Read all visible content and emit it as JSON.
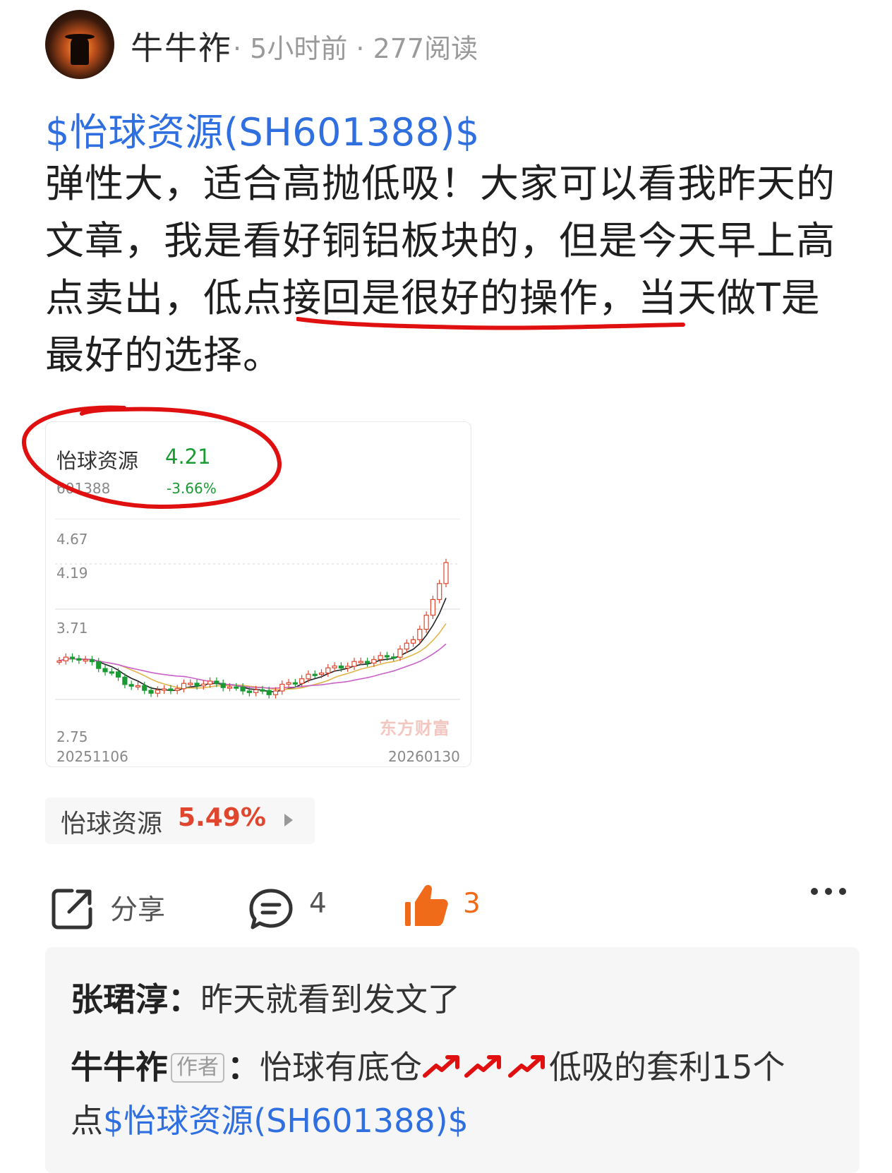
{
  "post": {
    "author": "牛牛祚",
    "meta": "· 5小时前 · 277阅读",
    "stock_link": "$怡球资源(SH601388)$",
    "body_before": "弹性大，适合高抛低吸！大家可以看我昨天的文章，我是看好铜铝板块的，但是今天早上高点卖出，",
    "body_underlined": "低点接回是很好的操作",
    "body_after": "，当天做T是最好的选择。"
  },
  "chart_card": {
    "name": "怡球资源",
    "price": "4.21",
    "code": "601388",
    "change": "-3.66%",
    "y_ticks": [
      "4.67",
      "4.19",
      "3.71",
      "2.75"
    ],
    "x_start": "20251106",
    "x_end": "20260130",
    "watermark": "东方财富"
  },
  "chart_data": {
    "type": "line",
    "title": "怡球资源",
    "ylim": [
      2.75,
      4.67
    ],
    "x": [
      "20251106",
      "20260130"
    ],
    "series": [
      {
        "name": "",
        "values": [
          3.16,
          3.2,
          3.12,
          3.02,
          2.9,
          2.84,
          2.84,
          2.9,
          2.92,
          2.92,
          2.86,
          2.84,
          2.82,
          2.92,
          2.98,
          3.06,
          3.1,
          3.14,
          3.18,
          3.22,
          3.36,
          3.66,
          4.21
        ]
      }
    ]
  },
  "stock_tag": {
    "name": "怡球资源",
    "change": "5.49%"
  },
  "actions": {
    "share_label": "分享",
    "comment_count": "4",
    "like_count": "3"
  },
  "comments": [
    {
      "user": "张珺淳",
      "sep": "：",
      "text": "昨天就看到发文了"
    },
    {
      "user": "牛牛祚",
      "badge": "作者",
      "sep": "：",
      "text": "怡球有底仓",
      "text2": "低吸的套利15个",
      "text3": "点",
      "link": "$怡球资源(SH601388)$"
    }
  ],
  "colors": {
    "link": "#2f6fdf",
    "up": "#e0462d",
    "down": "#1a9a32",
    "like": "#ef6b1a",
    "annotation": "#e01010"
  }
}
